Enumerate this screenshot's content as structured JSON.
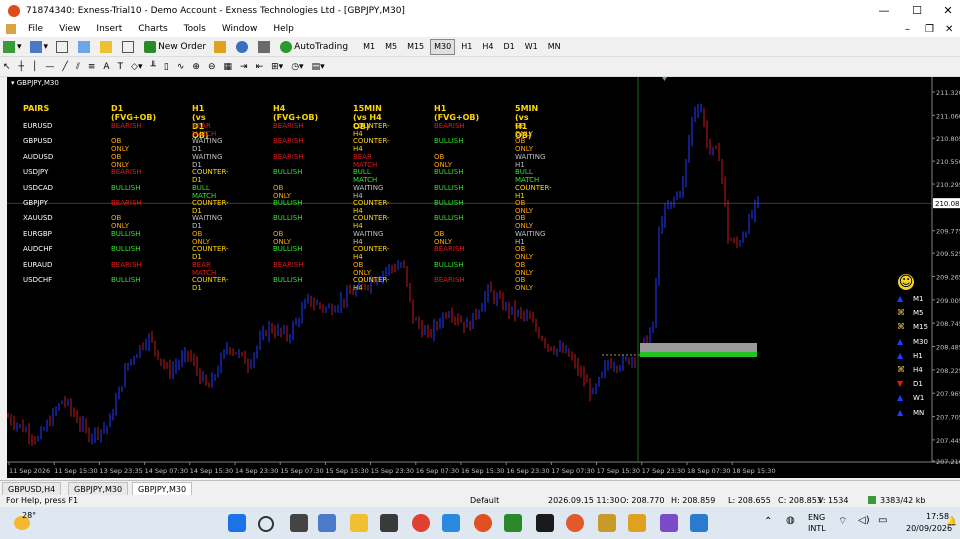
{
  "window": {
    "title": "71874340: Exness-Trial10 - Demo Account - Exness Technologies Ltd - [GBPJPY,M30]",
    "minimize": "—",
    "maximize": "☐",
    "close": "✕"
  },
  "menu": [
    "File",
    "View",
    "Insert",
    "Charts",
    "Tools",
    "Window",
    "Help"
  ],
  "toolbar": {
    "new_order": "New Order",
    "auto_trading": "AutoTrading",
    "timeframes": [
      "M1",
      "M5",
      "M15",
      "M30",
      "H1",
      "H4",
      "D1",
      "W1",
      "MN"
    ],
    "active_tf": "M30"
  },
  "chart": {
    "label": "GBPJPY,M30",
    "price_labels": [
      "211.320",
      "211.060",
      "210.805",
      "210.550",
      "210.295",
      "210.082",
      "209.775",
      "209.525",
      "209.265",
      "209.005",
      "208.745",
      "208.485",
      "208.225",
      "207.965",
      "207.705",
      "207.445",
      "207.210"
    ],
    "current_price": "210.082",
    "time_labels": [
      "11 Sep 2026",
      "11 Sep 15:30",
      "13 Sep 23:35",
      "14 Sep 07:30",
      "14 Sep 15:30",
      "14 Sep 23:30",
      "15 Sep 07:30",
      "15 Sep 15:30",
      "15 Sep 23:30",
      "16 Sep 07:30",
      "16 Sep 15:30",
      "16 Sep 23:30",
      "17 Sep 07:30",
      "17 Sep 15:30",
      "17 Sep 23:30",
      "18 Sep 07:30",
      "18 Sep 15:30"
    ],
    "mtf_labels": [
      "M1",
      "M5",
      "M15",
      "M30",
      "H1",
      "H4",
      "D1",
      "W1",
      "MN"
    ],
    "smiley": "☺",
    "colors": {
      "bull": "#1e3cff",
      "bear": "#c41a1a",
      "zone_grey": "#9a9a9a",
      "zone_green": "#22c322"
    }
  },
  "matrix": {
    "headers": [
      "PAIRS",
      "D1 (FVG+OB)",
      "H1 (vs D1 OB)",
      "H4 (FVG+OB)",
      "15MIN (vs H4 OB)",
      "H1 (FVG+OB)",
      "5MIN (vs H1 OB)"
    ],
    "rows": [
      {
        "pair": "EURUSD",
        "cells": [
          [
            "BEARISH",
            "#e01b1b"
          ],
          [
            "BEAR MATCH",
            "#e01b1b"
          ],
          [
            "BEARISH",
            "#e01b1b"
          ],
          [
            "COUNTER-H4",
            "#ffd700"
          ],
          [
            "BEARISH",
            "#e01b1b"
          ],
          [
            "OB ONLY",
            "#ffa500"
          ]
        ]
      },
      {
        "pair": "GBPUSD",
        "cells": [
          [
            "OB ONLY",
            "#ffa500"
          ],
          [
            "WAITING D1",
            "#c0c0c0"
          ],
          [
            "BEARISH",
            "#e01b1b"
          ],
          [
            "COUNTER-H4",
            "#ffd700"
          ],
          [
            "BULLISH",
            "#2ee02e"
          ],
          [
            "OB ONLY",
            "#ffa500"
          ]
        ]
      },
      {
        "pair": "AUDUSD",
        "cells": [
          [
            "OB ONLY",
            "#ffa500"
          ],
          [
            "WAITING D1",
            "#c0c0c0"
          ],
          [
            "BEARISH",
            "#e01b1b"
          ],
          [
            "BEAR MATCH",
            "#e01b1b"
          ],
          [
            "OB ONLY",
            "#ffa500"
          ],
          [
            "WAITING H1",
            "#c0c0c0"
          ]
        ]
      },
      {
        "pair": "USDJPY",
        "cells": [
          [
            "BEARISH",
            "#e01b1b"
          ],
          [
            "COUNTER-D1",
            "#ffd700"
          ],
          [
            "BULLISH",
            "#2ee02e"
          ],
          [
            "BULL MATCH",
            "#2ee02e"
          ],
          [
            "BULLISH",
            "#2ee02e"
          ],
          [
            "BULL MATCH",
            "#2ee02e"
          ]
        ]
      },
      {
        "pair": "USDCAD",
        "cells": [
          [
            "BULLISH",
            "#2ee02e"
          ],
          [
            "BULL MATCH",
            "#2ee02e"
          ],
          [
            "OB ONLY",
            "#ffa500"
          ],
          [
            "WAITING H4",
            "#c0c0c0"
          ],
          [
            "BULLISH",
            "#2ee02e"
          ],
          [
            "COUNTER-H1",
            "#ffd700"
          ]
        ]
      },
      {
        "pair": "GBPJPY",
        "cells": [
          [
            "BEARISH",
            "#e01b1b"
          ],
          [
            "COUNTER-D1",
            "#ffd700"
          ],
          [
            "BULLISH",
            "#2ee02e"
          ],
          [
            "COUNTER-H4",
            "#ffd700"
          ],
          [
            "BULLISH",
            "#2ee02e"
          ],
          [
            "OB ONLY",
            "#ffa500"
          ]
        ]
      },
      {
        "pair": "XAUUSD",
        "cells": [
          [
            "OB ONLY",
            "#ffa500"
          ],
          [
            "WAITING D1",
            "#c0c0c0"
          ],
          [
            "BULLISH",
            "#2ee02e"
          ],
          [
            "COUNTER-H4",
            "#ffd700"
          ],
          [
            "BULLISH",
            "#2ee02e"
          ],
          [
            "OB ONLY",
            "#ffa500"
          ]
        ]
      },
      {
        "pair": "EURGBP",
        "cells": [
          [
            "BULLISH",
            "#2ee02e"
          ],
          [
            "OB ONLY",
            "#ffa500"
          ],
          [
            "OB ONLY",
            "#ffa500"
          ],
          [
            "WAITING H4",
            "#c0c0c0"
          ],
          [
            "OB ONLY",
            "#ffa500"
          ],
          [
            "WAITING H1",
            "#c0c0c0"
          ]
        ]
      },
      {
        "pair": "AUDCHF",
        "cells": [
          [
            "BULLISH",
            "#2ee02e"
          ],
          [
            "COUNTER-D1",
            "#ffd700"
          ],
          [
            "BULLISH",
            "#2ee02e"
          ],
          [
            "COUNTER-H4",
            "#ffd700"
          ],
          [
            "BEARISH",
            "#e01b1b"
          ],
          [
            "OB ONLY",
            "#ffa500"
          ]
        ]
      },
      {
        "pair": "EURAUD",
        "cells": [
          [
            "BEARISH",
            "#e01b1b"
          ],
          [
            "BEAR MATCH",
            "#e01b1b"
          ],
          [
            "BEARISH",
            "#e01b1b"
          ],
          [
            "OB ONLY",
            "#ffa500"
          ],
          [
            "BULLISH",
            "#2ee02e"
          ],
          [
            "OB ONLY",
            "#ffa500"
          ]
        ]
      },
      {
        "pair": "USDCHF",
        "cells": [
          [
            "BULLISH",
            "#2ee02e"
          ],
          [
            "COUNTER-D1",
            "#ffd700"
          ],
          [
            "BULLISH",
            "#2ee02e"
          ],
          [
            "COUNTER-H4",
            "#ffd700"
          ],
          [
            "BEARISH",
            "#e01b1b"
          ],
          [
            "OB ONLY",
            "#ffa500"
          ]
        ]
      }
    ]
  },
  "tabs": [
    "GBPUSD,H4",
    "GBPJPY,M30",
    "GBPJPY,M30"
  ],
  "active_tab": 2,
  "status": {
    "help": "For Help, press F1",
    "profile": "Default",
    "datetime": "2026.09.15 11:30",
    "open": "O: 208.770",
    "high": "H: 208.859",
    "low": "L: 208.655",
    "close": "C: 208.853",
    "volume": "V: 1534",
    "traffic": "3383/42 kb"
  },
  "taskbar": {
    "weather": "28°",
    "lang1": "ENG",
    "lang2": "INTL",
    "time": "17:58",
    "date": "20/09/2026"
  }
}
